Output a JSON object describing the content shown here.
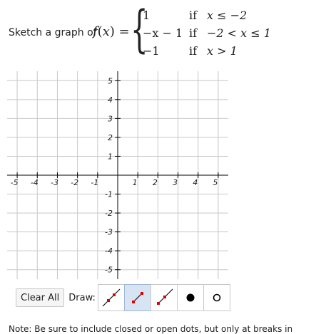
{
  "prompt": "Sketch a graph of",
  "function_name": "f(x) =",
  "pieces": [
    {
      "expr": "1",
      "cond_word": "if",
      "cond": "x ≤ −2"
    },
    {
      "expr": "−x − 1",
      "cond_word": "if",
      "cond": "−2 < x ≤ 1"
    },
    {
      "expr": "−1",
      "cond_word": "if",
      "cond": "x > 1"
    }
  ],
  "graph": {
    "x_ticks": [
      "-5",
      "-4",
      "-3",
      "-2",
      "-1",
      "1",
      "2",
      "3",
      "4",
      "5"
    ],
    "y_ticks": [
      "5",
      "4",
      "3",
      "2",
      "1",
      "-1",
      "-2",
      "-3",
      "-4",
      "-5"
    ],
    "x_range": [
      -5.5,
      5.5
    ],
    "y_range": [
      -5.5,
      5.5
    ]
  },
  "toolbar": {
    "clear_label": "Clear All",
    "draw_label": "Draw:",
    "tools": [
      {
        "icon": "line-tool-icon"
      },
      {
        "icon": "segment-tool-icon",
        "active": true
      },
      {
        "icon": "ray-tool-icon"
      },
      {
        "icon": "closed-dot-icon"
      },
      {
        "icon": "open-dot-icon"
      }
    ]
  },
  "note": "Note: Be sure to include closed or open dots, but only at breaks in"
}
